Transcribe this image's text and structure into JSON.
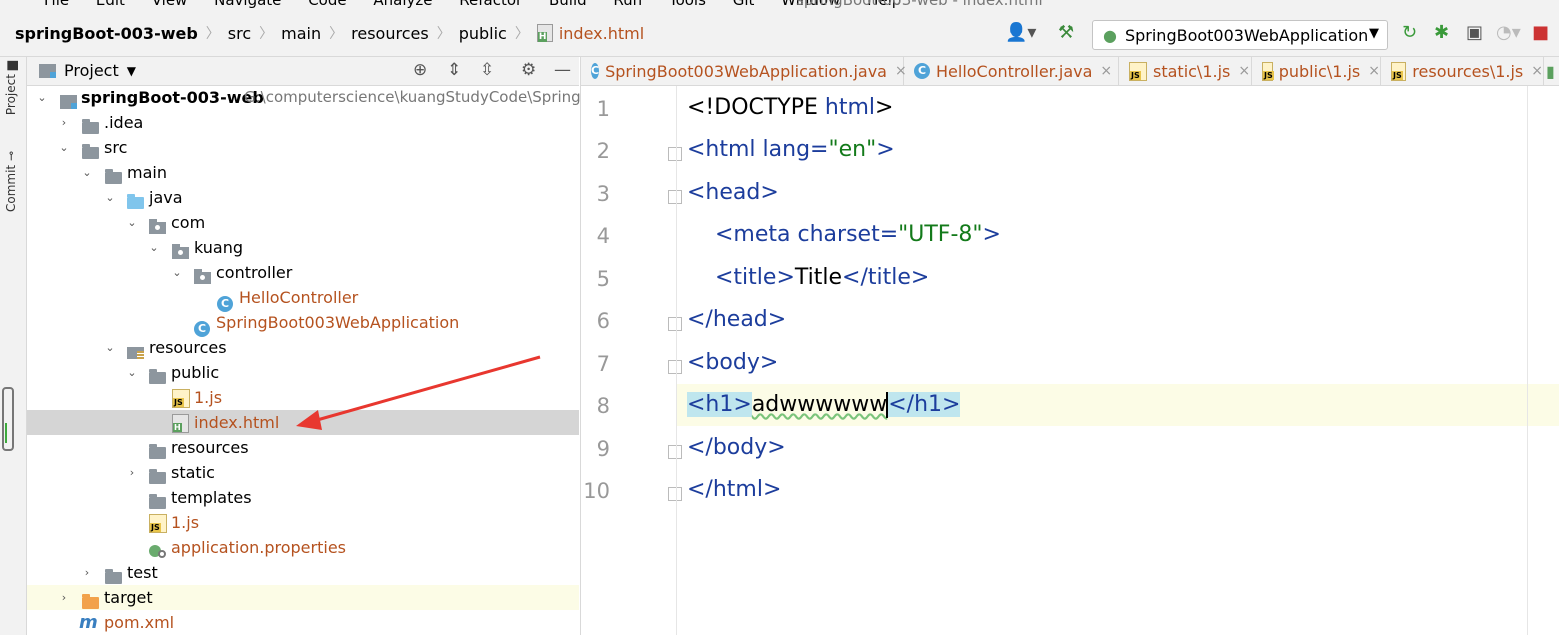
{
  "menu": {
    "items": [
      "File",
      "Edit",
      "View",
      "Navigate",
      "Code",
      "Analyze",
      "Refactor",
      "Build",
      "Run",
      "Tools",
      "Git",
      "Window",
      "Help"
    ],
    "title": "springBoot-003-web - index.html"
  },
  "breadcrumbs": {
    "project": "springBoot-003-web",
    "parts": [
      "src",
      "main",
      "resources",
      "public"
    ],
    "file": "index.html"
  },
  "toolbar": {
    "run_config": "SpringBoot003WebApplication"
  },
  "sidebar": {
    "project_tab": "Project",
    "commit_tab": "Commit"
  },
  "project_panel": {
    "title": "Project",
    "root_name": "springBoot-003-web",
    "root_path": "G:\\computerscience\\kuangStudyCode\\SpringB",
    "tree": [
      {
        "label": ".idea"
      },
      {
        "label": "src"
      },
      {
        "label": "main"
      },
      {
        "label": "java"
      },
      {
        "label": "com"
      },
      {
        "label": "kuang"
      },
      {
        "label": "controller"
      },
      {
        "label": "HelloController"
      },
      {
        "label": "SpringBoot003WebApplication"
      },
      {
        "label": "resources"
      },
      {
        "label": "public"
      },
      {
        "label": "1.js"
      },
      {
        "label": "index.html"
      },
      {
        "label": "resources"
      },
      {
        "label": "static"
      },
      {
        "label": "templates"
      },
      {
        "label": "1.js"
      },
      {
        "label": "application.properties"
      },
      {
        "label": "test"
      },
      {
        "label": "target"
      },
      {
        "label": "pom.xml"
      }
    ]
  },
  "editor": {
    "tabs": [
      {
        "label": "SpringBoot003WebApplication.java"
      },
      {
        "label": "HelloController.java"
      },
      {
        "label": "static\\1.js"
      },
      {
        "label": "public\\1.js"
      },
      {
        "label": "resources\\1.js"
      }
    ],
    "line_numbers": [
      "1",
      "2",
      "3",
      "4",
      "5",
      "6",
      "7",
      "8",
      "9",
      "10"
    ],
    "code": {
      "l1": "<!DOCTYPE",
      "l1b": " html",
      "l1c": ">",
      "l2_open": "<html ",
      "l2_attr": "lang=",
      "l2_val": "\"en\"",
      "l2_close": ">",
      "l3": "<head>",
      "l4_open": "<meta ",
      "l4_attr": "charset=",
      "l4_val": "\"UTF-8\"",
      "l4_close": ">",
      "l5_open": "<title>",
      "l5_text": "Title",
      "l5_close": "</title>",
      "l6": "</head>",
      "l7": "<body>",
      "l8_open": "<h1>",
      "l8_text": "adwwwwww",
      "l8_close": "</h1>",
      "l9": "</body>",
      "l10": "</html>"
    }
  },
  "colors": {
    "tag": "#1c3d9c",
    "string": "#137a1a",
    "file_modified": "#b5521f"
  }
}
